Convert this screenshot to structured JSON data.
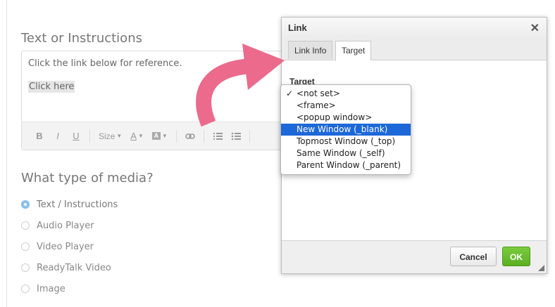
{
  "form": {
    "text_section_title": "Text or Instructions",
    "editor_line": "Click the link below for reference.",
    "editor_link": "Click here",
    "toolbar": {
      "bold": "B",
      "italic": "I",
      "underline": "U",
      "size_label": "Size",
      "font_color": "A",
      "bg_color": "A"
    },
    "media_title": "What type of media?",
    "media_options": [
      {
        "label": "Text / Instructions",
        "checked": true
      },
      {
        "label": "Audio Player",
        "checked": false
      },
      {
        "label": "Video Player",
        "checked": false
      },
      {
        "label": "ReadyTalk Video",
        "checked": false
      },
      {
        "label": "Image",
        "checked": false
      }
    ]
  },
  "dialog": {
    "title": "Link",
    "close": "✕",
    "tabs": [
      "Link Info",
      "Target"
    ],
    "active_tab": "Target",
    "target_label": "Target",
    "cancel_label": "Cancel",
    "ok_label": "OK"
  },
  "dropdown": {
    "selected_value": "<not set>",
    "highlighted_value": "New Window (_blank)",
    "options": [
      "<not set>",
      "<frame>",
      "<popup window>",
      "New Window (_blank)",
      "Topmost Window (_top)",
      "Same Window (_self)",
      "Parent Window (_parent)"
    ]
  },
  "colors": {
    "arrow": "#ec6a8c",
    "highlight": "#1d68d8",
    "ok_button": "#5cae24",
    "radio_checked": "#8ec3ee"
  }
}
